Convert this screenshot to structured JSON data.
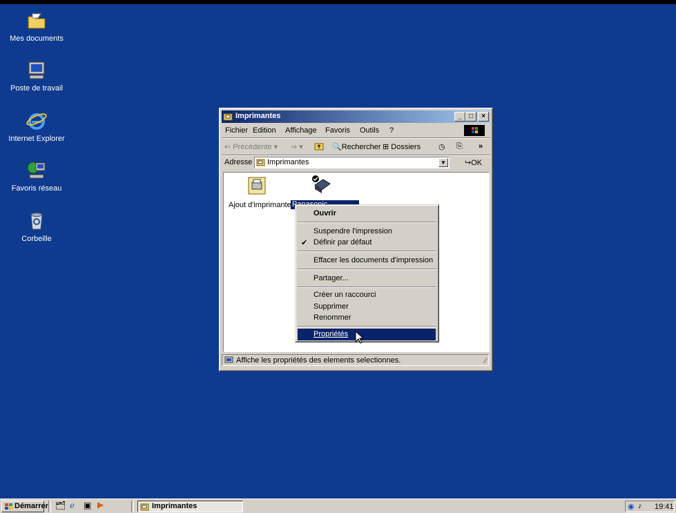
{
  "desktop": {
    "icons": [
      {
        "label": "Mes documents",
        "icon": "folder-icon"
      },
      {
        "label": "Poste de travail",
        "icon": "computer-icon"
      },
      {
        "label": "Internet Explorer",
        "icon": "internet-explorer-icon"
      },
      {
        "label": "Favoris réseau",
        "icon": "network-icon"
      },
      {
        "label": "Corbeille",
        "icon": "recycle-bin-icon"
      }
    ]
  },
  "window": {
    "title": "Imprimantes",
    "controls": {
      "minimize": "_",
      "maximize": "□",
      "close": "×"
    },
    "menu": [
      "Fichier",
      "Edition",
      "Affichage",
      "Favoris",
      "Outils",
      "?"
    ],
    "toolbar": {
      "back": "Précédente",
      "search": "Rechercher",
      "folders": "Dossiers"
    },
    "address": {
      "label": "Adresse",
      "value": "Imprimantes",
      "go": "OK"
    },
    "items": [
      {
        "label": "Ajout d'imprimante",
        "icon": "add-printer-icon"
      },
      {
        "label": "Panasonic",
        "icon": "printer-icon",
        "selected": true
      }
    ],
    "status": "Affiche les propriétés des elements selectionnes."
  },
  "context_menu": {
    "items": [
      {
        "label": "Ouvrir",
        "bold": true
      },
      {
        "label": "Suspendre l'impression"
      },
      {
        "label": "Définir par défaut",
        "checked": true
      },
      {
        "label": "Effacer les documents d'impression"
      },
      {
        "label": "Partager..."
      },
      {
        "label": "Créer un raccourci"
      },
      {
        "label": "Supprimer"
      },
      {
        "label": "Renommer"
      },
      {
        "label": "Propriétés",
        "highlighted": true
      }
    ]
  },
  "taskbar": {
    "start": "Démarrer",
    "task": "Imprimantes",
    "clock": "19:41"
  },
  "colors": {
    "desktop": "#0e3b8f",
    "titlebar_start": "#0a246a",
    "titlebar_end": "#a6caf0",
    "selection": "#0a246a",
    "face": "#d4d0c8"
  }
}
